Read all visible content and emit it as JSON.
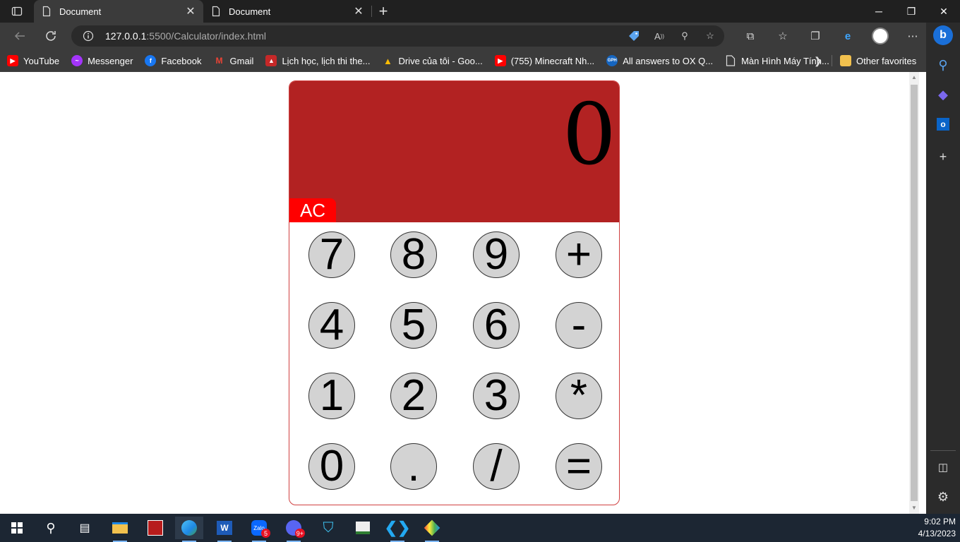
{
  "browser": {
    "tabs": [
      {
        "title": "Document",
        "active": true
      },
      {
        "title": "Document",
        "active": false
      }
    ],
    "address": {
      "host": "127.0.0.1",
      "path": ":5500/Calculator/index.html"
    },
    "favorites": [
      {
        "label": "YouTube",
        "icon": "youtube-icon",
        "color": "#ff0000"
      },
      {
        "label": "Messenger",
        "icon": "messenger-icon",
        "color": "#a334fa"
      },
      {
        "label": "Facebook",
        "icon": "facebook-icon",
        "color": "#1877f2"
      },
      {
        "label": "Gmail",
        "icon": "gmail-icon",
        "color": "#ea4335"
      },
      {
        "label": "Lịch học, lịch thi the...",
        "icon": "school-icon",
        "color": "#c62828"
      },
      {
        "label": "Drive của tôi - Goo...",
        "icon": "drive-icon",
        "color": "#1fa463"
      },
      {
        "label": "(755) Minecraft Nh...",
        "icon": "youtube-icon",
        "color": "#ff0000"
      },
      {
        "label": "All answers to OX Q...",
        "icon": "gph-icon",
        "color": "#1565c0"
      },
      {
        "label": "Màn Hình Máy Tính...",
        "icon": "page-icon",
        "color": "#3b3b3b"
      }
    ],
    "other_favorites": "Other favorites"
  },
  "calculator": {
    "display": "0",
    "clear_label": "AC",
    "keys": [
      "7",
      "8",
      "9",
      "+",
      "4",
      "5",
      "6",
      "-",
      "1",
      "2",
      "3",
      "*",
      "0",
      ".",
      "/",
      "="
    ]
  },
  "taskbar": {
    "time": "9:02 PM",
    "date": "4/13/2023",
    "zalo_badge": "5",
    "discord_badge": "9+"
  }
}
